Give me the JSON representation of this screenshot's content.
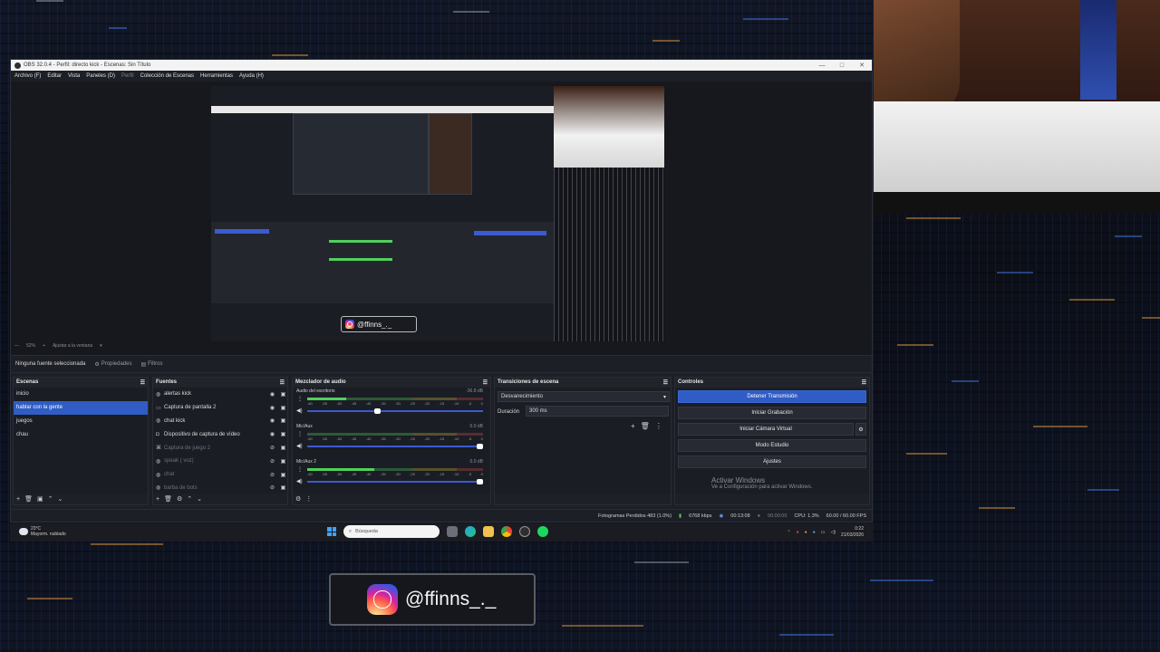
{
  "obs": {
    "title": "OBS 32.0.4 - Perfil: directo kick - Escenas: Sin Título",
    "window_buttons": [
      "—",
      "□",
      "✕"
    ],
    "menu": [
      "Archivo (F)",
      "Editar",
      "Vista",
      "Paneles (D)",
      "Perfil",
      "Colección de Escenas",
      "Herramientas",
      "Ayuda (H)"
    ],
    "zoom": "52%",
    "fit_label": "Ajustar a la ventana",
    "selection_text": "Ninguna fuente seleccionada",
    "properties_label": "Propiedades",
    "filters_label": "Filtros",
    "preview_handle": "@ffinns_._"
  },
  "scenes": {
    "title": "Escenas",
    "items": [
      "inicio",
      "hablar con la gente",
      "juegos",
      "chau"
    ],
    "selected_index": 1
  },
  "sources": {
    "title": "Fuentes",
    "items": [
      {
        "name": "alertas kick",
        "icon": "globe-icon",
        "visible": true
      },
      {
        "name": "Captura de pantalla 2",
        "icon": "monitor-icon",
        "visible": true
      },
      {
        "name": "chat kick",
        "icon": "globe-icon",
        "visible": true
      },
      {
        "name": "Dispositivo de captura de vídeo",
        "icon": "camera-icon",
        "visible": true
      },
      {
        "name": "Captura de juego 2",
        "icon": "gamepad-icon",
        "visible": false
      },
      {
        "name": "speak ( voz)",
        "icon": "globe-icon",
        "visible": false
      },
      {
        "name": "chat",
        "icon": "globe-icon",
        "visible": false
      },
      {
        "name": "barba de bots",
        "icon": "globe-icon",
        "visible": false
      }
    ]
  },
  "mixer": {
    "title": "Mezclador de audio",
    "ticks": [
      "-60",
      "-55",
      "-50",
      "-45",
      "-40",
      "-35",
      "-30",
      "-25",
      "-20",
      "-15",
      "-10",
      "-5",
      "0"
    ],
    "channels": [
      {
        "name": "Audio del escritorio",
        "db": "-36.8 dB",
        "level": 0.22,
        "volume": 0.42
      },
      {
        "name": "Mic/Aux",
        "db": "0.0 dB",
        "level": 0.0,
        "volume": 1.0
      },
      {
        "name": "Mic/Aux 2",
        "db": "0.0 dB",
        "level": 0.38,
        "volume": 1.0
      }
    ]
  },
  "transitions": {
    "title": "Transiciones de escena",
    "selected": "Desvanecimiento",
    "duration_label": "Duración",
    "duration_value": "300 ms"
  },
  "controls": {
    "title": "Controles",
    "buttons": [
      "Detener Transmisión",
      "Iniciar Grabación",
      "Iniciar Cámara Virtual",
      "Modo Estudio",
      "Ajustes"
    ],
    "activate_title": "Activar Windows",
    "activate_sub": "Ve a Configuración para activar Windows."
  },
  "status": {
    "dropped": "Fotogramas Perdidos 483 (1.0%)",
    "bitrate": "6768 kbps",
    "stream_time": "00:13:08",
    "rec_time": "00:00:00",
    "cpu": "CPU: 1.3%",
    "fps": "60.00 / 60.00 FPS"
  },
  "taskbar": {
    "temp": "23°C",
    "weather": "Mayorm. nublado",
    "search_placeholder": "Búsqueda",
    "time": "0:22",
    "date": "21/03/2026"
  },
  "badge": {
    "handle": "@ffinns_._"
  },
  "colors": {
    "accent": "#2f5cc5",
    "meter_green": "#4fd15c"
  }
}
